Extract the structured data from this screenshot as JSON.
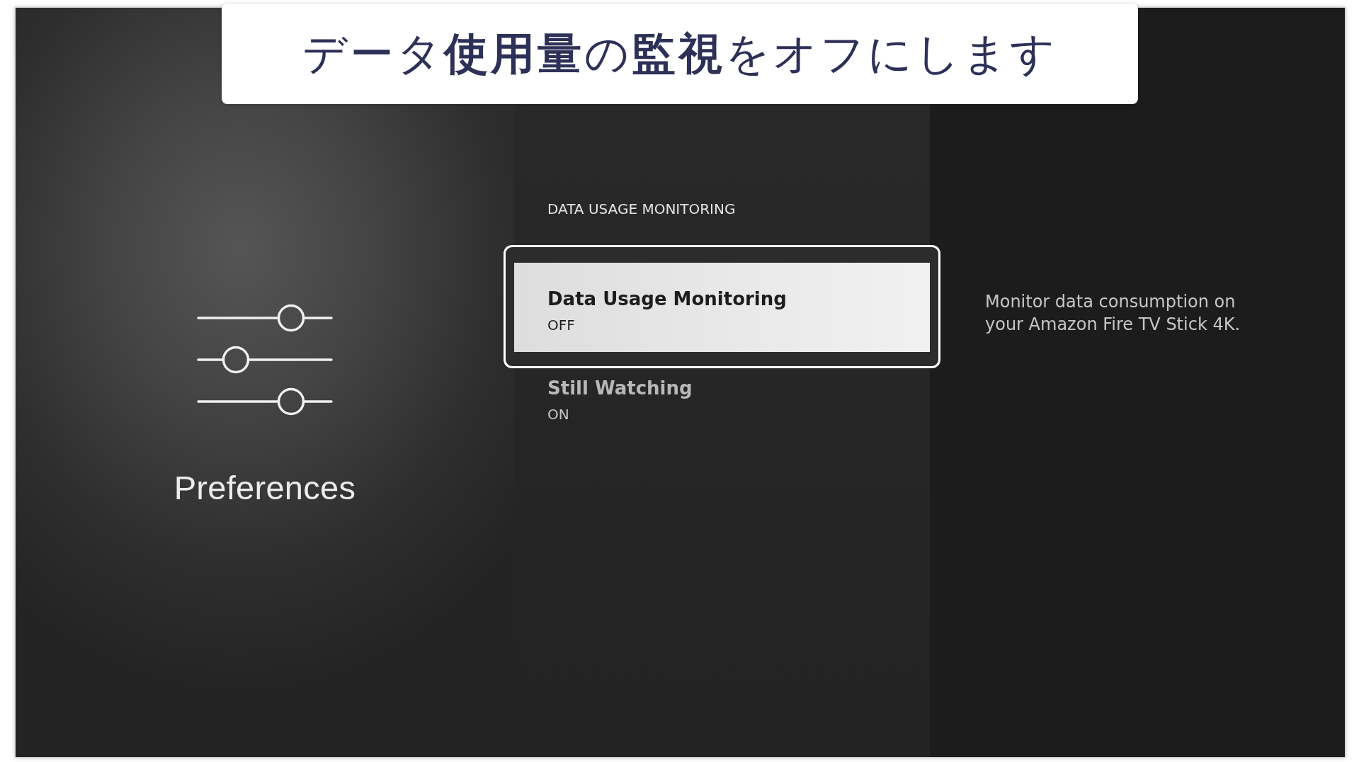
{
  "caption": {
    "text": "データ**使用量**の**監視**をオフにします"
  },
  "sidebar": {
    "title": "Preferences"
  },
  "section": {
    "heading": "DATA USAGE MONITORING",
    "items": [
      {
        "label": "Data Usage Monitoring",
        "value": "OFF",
        "selected": true
      },
      {
        "label": "Still Watching",
        "value": "ON",
        "selected": false
      }
    ]
  },
  "description": "Monitor data consumption on your Amazon Fire TV Stick 4K."
}
